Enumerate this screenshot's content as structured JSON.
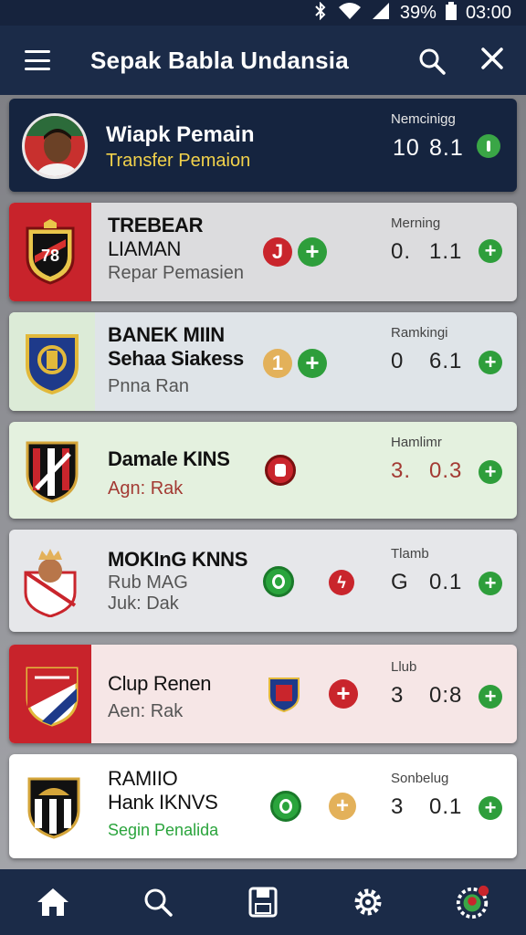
{
  "status_bar": {
    "battery": "39%",
    "time": "03:00",
    "icons": [
      "bluetooth-icon",
      "wifi-icon",
      "signal-icon",
      "battery-icon"
    ]
  },
  "app_bar": {
    "title": "Sepak Babla Undansia",
    "icons": [
      "menu-icon",
      "search-icon",
      "close-icon"
    ]
  },
  "featured": {
    "name": "Wiapk Pemain",
    "subtitle": "Transfer Pemaion",
    "stat_label": "Nemcinigg",
    "val1": "10",
    "val2": "8.1"
  },
  "clubs": [
    {
      "line1": "TREBEAR",
      "line2": "LIAMAN",
      "sub": "Repar Pemasien",
      "stat_label": "Merning",
      "val1": "0.",
      "val2": "1.1",
      "badge": "J"
    },
    {
      "line1": "BANEK MIIN",
      "line2": "Sehaa Siakess",
      "sub": "Pnna Ran",
      "stat_label": "Ramkingi",
      "val1": "0",
      "val2": "6.1",
      "badge": "1"
    },
    {
      "line1": "Damale KINS",
      "line2": "",
      "sub": "Agn: Rak",
      "stat_label": "Hamlimr",
      "val1": "3.",
      "val2": "0.3",
      "badge": ""
    },
    {
      "line1": "MOKInG KNNS",
      "line2": "Rub MAG",
      "sub": "Juk: Dak",
      "stat_label": "Tlamb",
      "val1": "G",
      "val2": "0.1",
      "badge": ""
    },
    {
      "line1": "Clup Renen",
      "line2": "",
      "sub": "Aen: Rak",
      "stat_label": "Llub",
      "val1": "3",
      "val2": "0:8",
      "badge": ""
    },
    {
      "line1": "RAMIIO",
      "line2": "Hank IKNVS",
      "sub": "Segin Penalida",
      "stat_label": "Sonbelug",
      "val1": "3",
      "val2": "0.1",
      "badge": ""
    }
  ],
  "colors": {
    "primary": "#1b2b48",
    "green": "#2e9e3b",
    "red": "#c9252c",
    "gold": "#e3b15a",
    "featured_subtitle": "#f2d24b",
    "sub_green": "#2aa43c",
    "sub_red": "#a33a33"
  },
  "bottom_nav": [
    "home-icon",
    "search-icon",
    "save-icon",
    "settings-icon",
    "profile-icon"
  ]
}
